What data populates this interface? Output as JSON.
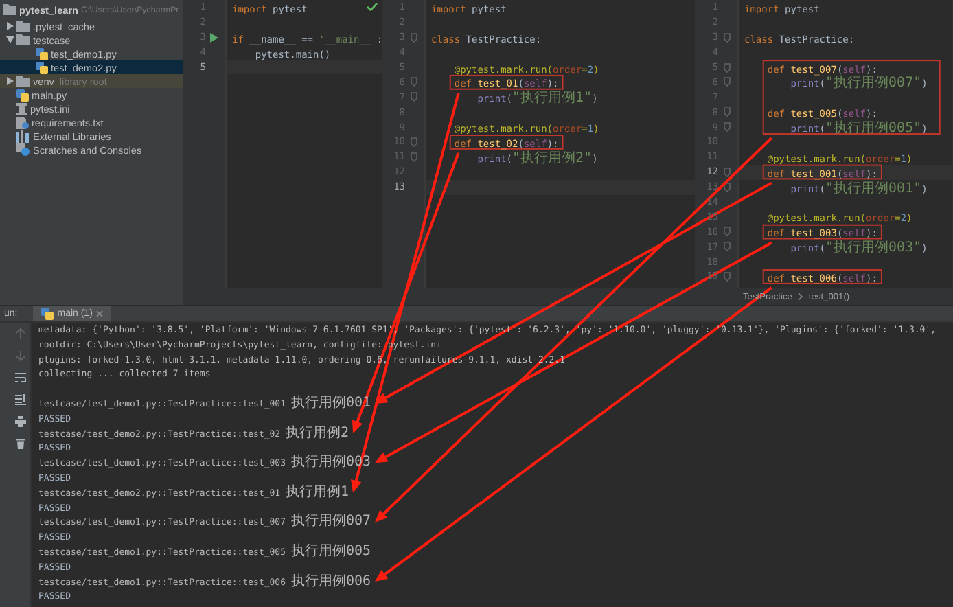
{
  "project_tree": {
    "root": {
      "name": "pytest_learn",
      "path": "C:\\Users\\User\\PycharmPr"
    },
    "items": [
      {
        "name": ".pytest_cache",
        "kind": "folder",
        "expanded": false,
        "selected": false
      },
      {
        "name": "testcase",
        "kind": "folder",
        "expanded": true,
        "selected": false,
        "children": [
          {
            "name": "test_demo1.py",
            "kind": "python",
            "selected": false
          },
          {
            "name": "test_demo2.py",
            "kind": "python",
            "selected": true
          }
        ]
      },
      {
        "name": "venv",
        "kind": "folder",
        "expanded": false,
        "selected": false,
        "note": "library root",
        "library_root": true
      },
      {
        "name": "main.py",
        "kind": "python",
        "selected": false
      },
      {
        "name": "pytest.ini",
        "kind": "ini",
        "selected": false
      },
      {
        "name": "requirements.txt",
        "kind": "text",
        "selected": false
      },
      {
        "name": "External Libraries",
        "kind": "libraries",
        "selected": false
      },
      {
        "name": "Scratches and Consoles",
        "kind": "scratches",
        "selected": false
      }
    ]
  },
  "editors": [
    {
      "inspection_ok": true,
      "lines": [
        {
          "number": "1",
          "current": false,
          "tokens": [
            {
              "kind": "keyword",
              "text": "import"
            },
            {
              "kind": "plain",
              "text": " pytest"
            }
          ]
        },
        {
          "number": "2",
          "current": false
        },
        {
          "number": "3",
          "current": false,
          "run_marker": true,
          "tokens": [
            {
              "kind": "keyword",
              "text": "if"
            },
            {
              "kind": "plain",
              "text": " __name__ == "
            },
            {
              "kind": "string",
              "text": "'__main__'"
            },
            {
              "kind": "plain",
              "text": ":"
            }
          ]
        },
        {
          "number": "4",
          "current": false,
          "tokens": [
            {
              "kind": "plain",
              "text": "    pytest.main()"
            }
          ]
        },
        {
          "number": "5",
          "current": true
        }
      ]
    },
    {
      "lines": [
        {
          "number": "1",
          "current": false,
          "tokens": [
            {
              "kind": "keyword",
              "text": "import"
            },
            {
              "kind": "plain",
              "text": " pytest"
            }
          ]
        },
        {
          "number": "2",
          "current": false
        },
        {
          "number": "3",
          "current": false,
          "fold": true,
          "tokens": [
            {
              "kind": "keyword",
              "text": "class"
            },
            {
              "kind": "plain",
              "text": " TestPractice:"
            }
          ]
        },
        {
          "number": "4",
          "current": false
        },
        {
          "number": "5",
          "current": false,
          "tokens": [
            {
              "kind": "decorator",
              "text": "    @pytest.mark.run("
            },
            {
              "kind": "param",
              "text": "order"
            },
            {
              "kind": "decorator",
              "text": "="
            },
            {
              "kind": "number",
              "text": "2"
            },
            {
              "kind": "decorator",
              "text": ")"
            }
          ]
        },
        {
          "number": "6",
          "current": false,
          "fold": true,
          "boxed": true,
          "tokens": [
            {
              "kind": "keyword",
              "text": "    def "
            },
            {
              "kind": "function",
              "text": "test_01"
            },
            {
              "kind": "plain",
              "text": "("
            },
            {
              "kind": "self",
              "text": "self"
            },
            {
              "kind": "plain",
              "text": "):"
            }
          ]
        },
        {
          "number": "7",
          "current": false,
          "fold": true,
          "tokens": [
            {
              "kind": "builtin",
              "text": "        print"
            },
            {
              "kind": "plain",
              "text": "("
            },
            {
              "kind": "cjk_string",
              "text": "\"执行用例1\""
            },
            {
              "kind": "plain",
              "text": ")"
            }
          ]
        },
        {
          "number": "8",
          "current": false
        },
        {
          "number": "9",
          "current": false,
          "tokens": [
            {
              "kind": "decorator",
              "text": "    @pytest.mark.run("
            },
            {
              "kind": "param",
              "text": "order"
            },
            {
              "kind": "decorator",
              "text": "="
            },
            {
              "kind": "number",
              "text": "1"
            },
            {
              "kind": "decorator",
              "text": ")"
            }
          ]
        },
        {
          "number": "10",
          "current": false,
          "fold": true,
          "boxed": true,
          "tokens": [
            {
              "kind": "keyword",
              "text": "    def "
            },
            {
              "kind": "function",
              "text": "test_02"
            },
            {
              "kind": "plain",
              "text": "("
            },
            {
              "kind": "self",
              "text": "self"
            },
            {
              "kind": "plain",
              "text": "):"
            }
          ]
        },
        {
          "number": "11",
          "current": false,
          "fold": true,
          "tokens": [
            {
              "kind": "builtin",
              "text": "        print"
            },
            {
              "kind": "plain",
              "text": "("
            },
            {
              "kind": "cjk_string",
              "text": "\"执行用例2\""
            },
            {
              "kind": "plain",
              "text": ")"
            }
          ]
        },
        {
          "number": "12",
          "current": false
        },
        {
          "number": "13",
          "current": true
        }
      ]
    },
    {
      "breadcrumbs": [
        "TestPractice",
        "test_001()"
      ],
      "lines": [
        {
          "number": "1",
          "current": false,
          "tokens": [
            {
              "kind": "keyword",
              "text": "import"
            },
            {
              "kind": "plain",
              "text": " pytest"
            }
          ]
        },
        {
          "number": "2",
          "current": false
        },
        {
          "number": "3",
          "current": false,
          "fold": true,
          "tokens": [
            {
              "kind": "keyword",
              "text": "class"
            },
            {
              "kind": "plain",
              "text": " TestPractice:"
            }
          ]
        },
        {
          "number": "4",
          "current": false
        },
        {
          "number": "5",
          "current": false,
          "fold": true,
          "boxed": true,
          "tokens": [
            {
              "kind": "keyword",
              "text": "    def "
            },
            {
              "kind": "function",
              "text": "test_007"
            },
            {
              "kind": "plain",
              "text": "("
            },
            {
              "kind": "self",
              "text": "self"
            },
            {
              "kind": "plain",
              "text": "):"
            }
          ]
        },
        {
          "number": "6",
          "current": false,
          "fold": true,
          "boxed": true,
          "tokens": [
            {
              "kind": "builtin",
              "text": "        print"
            },
            {
              "kind": "plain",
              "text": "("
            },
            {
              "kind": "cjk_string",
              "text": "\"执行用例007\""
            },
            {
              "kind": "plain",
              "text": ")"
            }
          ]
        },
        {
          "number": "7",
          "current": false,
          "boxed": true
        },
        {
          "number": "8",
          "current": false,
          "fold": true,
          "boxed": true,
          "tokens": [
            {
              "kind": "keyword",
              "text": "    def "
            },
            {
              "kind": "function",
              "text": "test_005"
            },
            {
              "kind": "plain",
              "text": "("
            },
            {
              "kind": "self",
              "text": "self"
            },
            {
              "kind": "plain",
              "text": "):"
            }
          ]
        },
        {
          "number": "9",
          "current": false,
          "fold": true,
          "boxed": true,
          "tokens": [
            {
              "kind": "builtin",
              "text": "        print"
            },
            {
              "kind": "plain",
              "text": "("
            },
            {
              "kind": "cjk_string",
              "text": "\"执行用例005\""
            },
            {
              "kind": "plain",
              "text": ")"
            }
          ]
        },
        {
          "number": "10",
          "current": false
        },
        {
          "number": "11",
          "current": false,
          "tokens": [
            {
              "kind": "decorator",
              "text": "    @pytest.mark.run("
            },
            {
              "kind": "param",
              "text": "order"
            },
            {
              "kind": "decorator",
              "text": "="
            },
            {
              "kind": "number",
              "text": "1"
            },
            {
              "kind": "decorator",
              "text": ")"
            }
          ]
        },
        {
          "number": "12",
          "current": true,
          "fold": true,
          "boxed": true,
          "tokens": [
            {
              "kind": "keyword",
              "text": "    def "
            },
            {
              "kind": "function",
              "text": "test_001"
            },
            {
              "kind": "plain",
              "text": "("
            },
            {
              "kind": "self",
              "text": "self"
            },
            {
              "kind": "plain",
              "text": "):"
            }
          ]
        },
        {
          "number": "13",
          "current": false,
          "fold": true,
          "tokens": [
            {
              "kind": "builtin",
              "text": "        print"
            },
            {
              "kind": "plain",
              "text": "("
            },
            {
              "kind": "cjk_string",
              "text": "\"执行用例001\""
            },
            {
              "kind": "plain",
              "text": ")"
            }
          ]
        },
        {
          "number": "14",
          "current": false
        },
        {
          "number": "15",
          "current": false,
          "tokens": [
            {
              "kind": "decorator",
              "text": "    @pytest.mark.run("
            },
            {
              "kind": "param",
              "text": "order"
            },
            {
              "kind": "decorator",
              "text": "="
            },
            {
              "kind": "number",
              "text": "2"
            },
            {
              "kind": "decorator",
              "text": ")"
            }
          ]
        },
        {
          "number": "16",
          "current": false,
          "fold": true,
          "boxed": true,
          "tokens": [
            {
              "kind": "keyword",
              "text": "    def "
            },
            {
              "kind": "function",
              "text": "test_003"
            },
            {
              "kind": "plain",
              "text": "("
            },
            {
              "kind": "self",
              "text": "self"
            },
            {
              "kind": "plain",
              "text": "):"
            }
          ]
        },
        {
          "number": "17",
          "current": false,
          "fold": true,
          "tokens": [
            {
              "kind": "builtin",
              "text": "        print"
            },
            {
              "kind": "plain",
              "text": "("
            },
            {
              "kind": "cjk_string",
              "text": "\"执行用例003\""
            },
            {
              "kind": "plain",
              "text": ")"
            }
          ]
        },
        {
          "number": "18",
          "current": false
        },
        {
          "number": "19",
          "current": false,
          "fold": true,
          "boxed": true,
          "tokens": [
            {
              "kind": "keyword",
              "text": "    def "
            },
            {
              "kind": "function",
              "text": "test_006"
            },
            {
              "kind": "plain",
              "text": "("
            },
            {
              "kind": "self",
              "text": "self"
            },
            {
              "kind": "plain",
              "text": "):"
            }
          ]
        }
      ]
    }
  ],
  "run_panel": {
    "label_fragment": "un:",
    "tab": {
      "label": "main (1)",
      "selected": true
    },
    "lines": [
      {
        "kind": "info",
        "text": "metadata: {'Python': '3.8.5', 'Platform': 'Windows-7-6.1.7601-SP1', 'Packages': {'pytest': '6.2.3', 'py': '1.10.0', 'pluggy': '0.13.1'}, 'Plugins': {'forked': '1.3.0',"
      },
      {
        "kind": "info",
        "text": "rootdir: C:\\Users\\User\\PycharmProjects\\pytest_learn, configfile: pytest.ini"
      },
      {
        "kind": "info",
        "text": "plugins: forked-1.3.0, html-3.1.1, metadata-1.11.0, ordering-0.6, rerunfailures-9.1.1, xdist-2.2.1"
      },
      {
        "kind": "info",
        "text": "collecting ... collected 7 items"
      },
      {
        "kind": "test",
        "text": "testcase/test_demo1.py::TestPractice::test_001",
        "output": "执行用例001"
      },
      {
        "kind": "status",
        "text": "PASSED"
      },
      {
        "kind": "test",
        "text": "testcase/test_demo2.py::TestPractice::test_02",
        "output": "执行用例2"
      },
      {
        "kind": "status",
        "text": "PASSED"
      },
      {
        "kind": "test",
        "text": "testcase/test_demo1.py::TestPractice::test_003",
        "output": "执行用例003"
      },
      {
        "kind": "status",
        "text": "PASSED"
      },
      {
        "kind": "test",
        "text": "testcase/test_demo2.py::TestPractice::test_01",
        "output": "执行用例1"
      },
      {
        "kind": "status",
        "text": "PASSED"
      },
      {
        "kind": "test",
        "text": "testcase/test_demo1.py::TestPractice::test_007",
        "output": "执行用例007"
      },
      {
        "kind": "status",
        "text": "PASSED"
      },
      {
        "kind": "test",
        "text": "testcase/test_demo1.py::TestPractice::test_005",
        "output": "执行用例005"
      },
      {
        "kind": "status",
        "text": "PASSED"
      },
      {
        "kind": "test",
        "text": "testcase/test_demo1.py::TestPractice::test_006",
        "output": "执行用例006"
      },
      {
        "kind": "status",
        "text": "PASSED"
      }
    ]
  }
}
